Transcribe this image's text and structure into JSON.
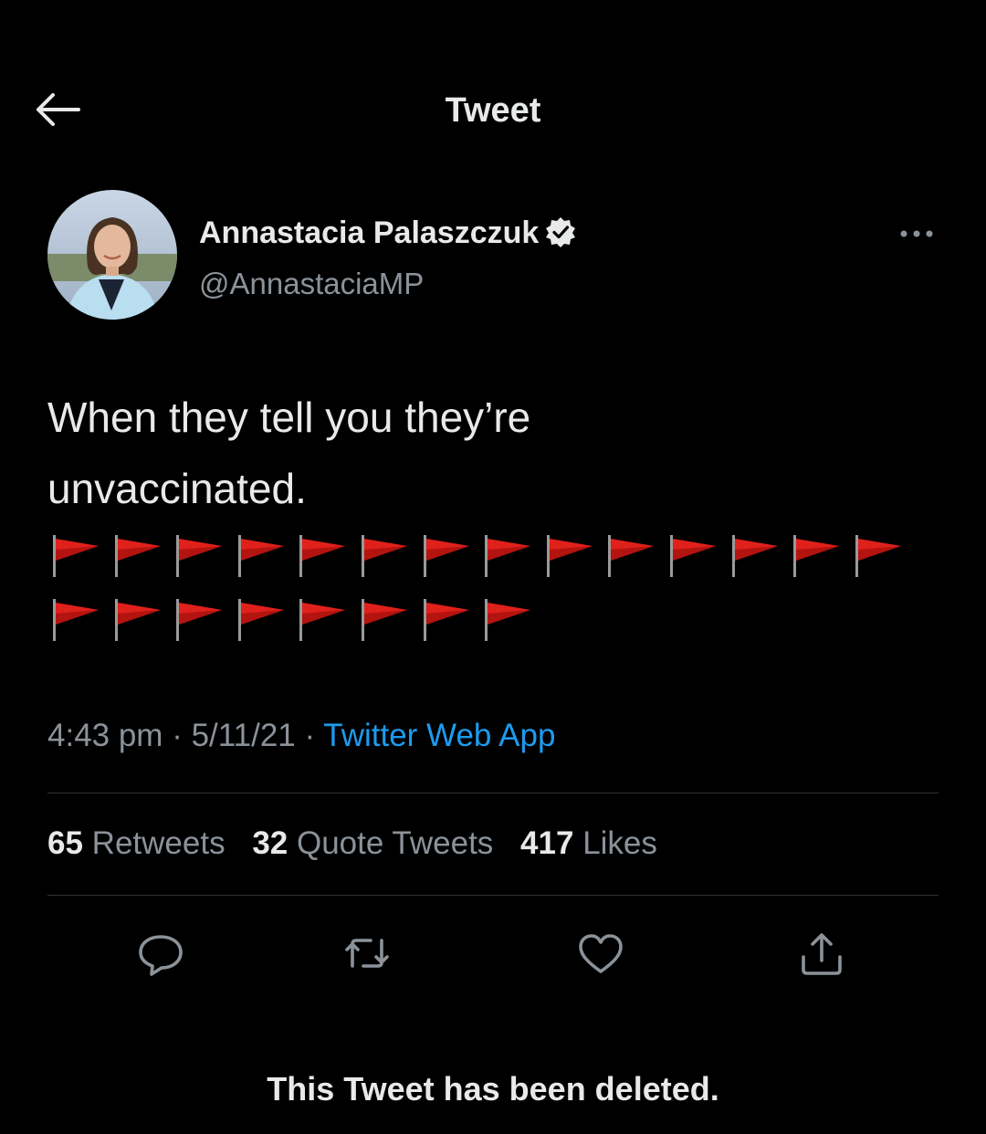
{
  "header": {
    "title": "Tweet",
    "back_icon": "arrow-left-icon"
  },
  "author": {
    "display_name": "Annastacia Palaszczuk",
    "handle": "@AnnastaciaMP",
    "verified": true,
    "avatar_icon": "avatar-photo"
  },
  "tweet": {
    "text_line1": "When they tell you they’re",
    "text_line2": "unvaccinated.",
    "flag_emoji": "triangular-flag",
    "flag_rows": [
      14,
      8
    ],
    "time": "4:43 pm",
    "date": "5/11/21",
    "separator": "·",
    "source": "Twitter Web App"
  },
  "stats": {
    "retweets_count": "65",
    "retweets_label": "Retweets",
    "quotes_count": "32",
    "quotes_label": "Quote Tweets",
    "likes_count": "417",
    "likes_label": "Likes"
  },
  "actions": {
    "reply_icon": "reply-icon",
    "retweet_icon": "retweet-icon",
    "like_icon": "heart-icon",
    "share_icon": "share-icon"
  },
  "notice": "This Tweet has been deleted.",
  "colors": {
    "background": "#000000",
    "text": "#e7e9ea",
    "muted": "#8b9299",
    "link": "#1d9bf0",
    "flag": "#e0201b"
  }
}
